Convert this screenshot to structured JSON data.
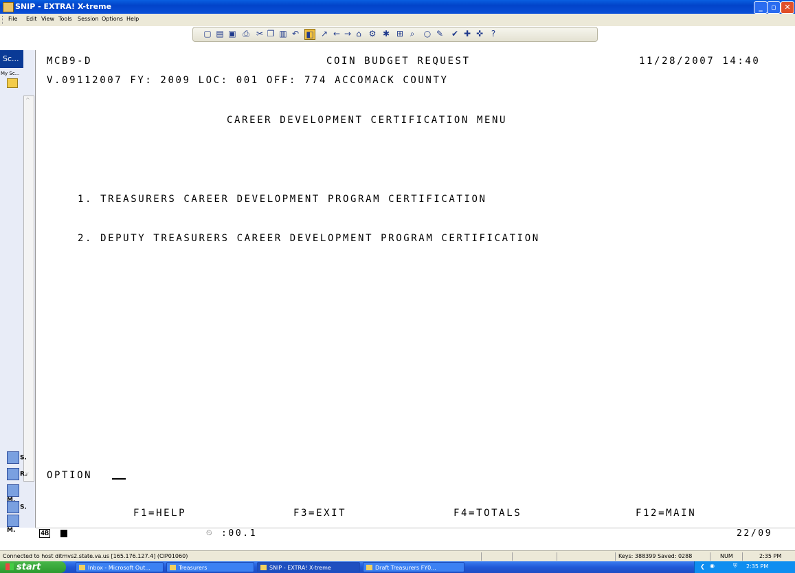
{
  "window": {
    "title": "SNIP - EXTRA! X-treme"
  },
  "menu": [
    "File",
    "Edit",
    "View",
    "Tools",
    "Session",
    "Options",
    "Help"
  ],
  "toolbar_icons": [
    "new-icon",
    "open-icon",
    "save-icon",
    "print-icon",
    "cut-icon",
    "copy-icon",
    "paste-icon",
    "undo-icon",
    "highlight-icon",
    "chart-icon",
    "back-icon",
    "forward-icon",
    "home-icon",
    "settings-icon",
    "tools-icon",
    "zoom-icon",
    "find-icon",
    "circle-icon",
    "edit-icon",
    "check-icon",
    "macro-icon",
    "help-icon"
  ],
  "left_pane": {
    "tab_label": "Sc...",
    "my_sc_label": "My Sc...",
    "buttons": [
      "S.",
      "R.",
      "M.",
      "S.",
      "M."
    ]
  },
  "terminal": {
    "code": "MCB9-D",
    "header_title": "COIN BUDGET REQUEST",
    "datetime": "11/28/2007 14:40",
    "version_line": "V.09112007 FY: 2009 LOC: 001 OFF: 774 ACCOMACK COUNTY",
    "menu_title": "CAREER DEVELOPMENT CERTIFICATION MENU",
    "options": [
      "1. TREASURERS CAREER DEVELOPMENT PROGRAM CERTIFICATION",
      "2. DEPUTY TREASURERS CAREER DEVELOPMENT PROGRAM CERTIFICATION"
    ],
    "option_label": "OPTION",
    "function_keys": [
      "F1=HELP",
      "F3=EXIT",
      "F4=TOTALS",
      "F12=MAIN"
    ]
  },
  "oia": {
    "indicator": "4B",
    "timer": ":00.1",
    "cursor_pos": "22/09"
  },
  "statusbar": {
    "connection": "Connected to host ditmvs2.state.va.us [165.176.127.4] (CIP01060)",
    "keys": "Keys: 388399 Saved: 0288",
    "num": "NUM",
    "time": "2:35 PM"
  },
  "taskbar": {
    "start_label": "start",
    "tasks": [
      "Inbox - Microsoft Out...",
      "Treasurers",
      "SNIP - EXTRA! X-treme",
      "Draft Treasurers FY0..."
    ],
    "clock": "2:35 PM"
  }
}
